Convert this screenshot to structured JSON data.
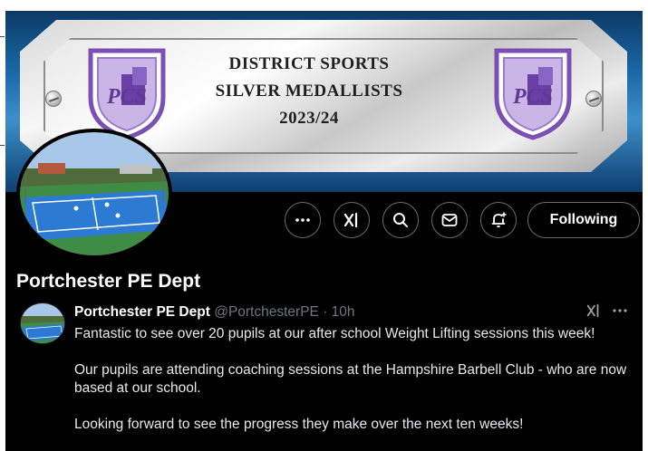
{
  "banner": {
    "line1": "DISTRICT SPORTS",
    "line2": "SILVER MEDALLISTS",
    "line3": "2023/24",
    "crest_text": "PCS"
  },
  "actions": {
    "more_icon": "more-icon",
    "grok_icon": "grok-icon",
    "search_icon": "search-icon",
    "message_icon": "message-icon",
    "notify_icon": "notification-bell-icon",
    "follow_label": "Following"
  },
  "profile": {
    "name": "Portchester PE Dept"
  },
  "tweet": {
    "author": "Portchester PE Dept",
    "handle": "@PortchesterPE",
    "separator": "·",
    "time": "10h",
    "paragraphs": [
      "Fantastic to see over 20 pupils at our after school Weight Lifting sessions this week!",
      "Our pupils are attending coaching sessions at the Hampshire Barbell Club - who are now based at our school.",
      "Looking forward to see the progress they make over the next ten weeks!"
    ]
  },
  "colors": {
    "background": "#000000",
    "muted": "#71767b",
    "text": "#e7e9ea",
    "crest_purple": "#7b4fb3"
  }
}
